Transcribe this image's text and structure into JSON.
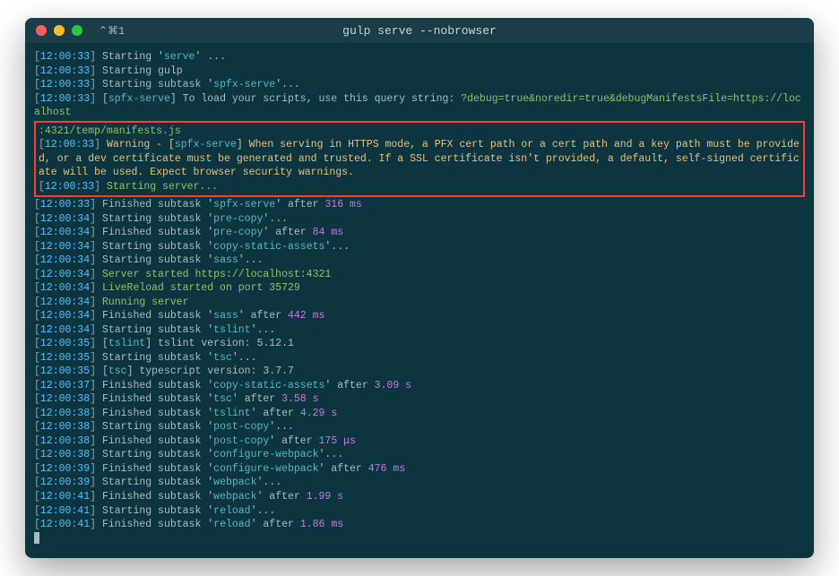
{
  "window": {
    "tab_indicator": "⌃⌘1",
    "title": "gulp serve --nobrowser"
  },
  "highlight_block": {
    "line1_pre": ":4321/temp/manifests.js",
    "ts": "12:00:33",
    "warn_prefix": "Warning - [",
    "warn_mod": "spfx-serve",
    "warn_msg": "] When serving in HTTPS mode, a PFX cert path or a cert path and a key path must be provided, or a dev certificate must be generated and trusted. If a SSL certificate isn't provided, a default, self-signed certificate will be used. Expect browser security warnings.",
    "start_server": "Starting server..."
  },
  "lines": [
    {
      "ts": "12:00:33",
      "segs": [
        [
          "gray",
          "Starting '"
        ],
        [
          "cyan",
          "serve"
        ],
        [
          "gray",
          "' ..."
        ]
      ]
    },
    {
      "ts": "12:00:33",
      "segs": [
        [
          "gray",
          "Starting gulp"
        ]
      ]
    },
    {
      "ts": "12:00:33",
      "segs": [
        [
          "gray",
          "Starting subtask '"
        ],
        [
          "cyan",
          "spfx-serve"
        ],
        [
          "gray",
          "'..."
        ]
      ]
    },
    {
      "ts": "12:00:33",
      "segs": [
        [
          "gray",
          "["
        ],
        [
          "cyan",
          "spfx-serve"
        ],
        [
          "gray",
          "] To load your scripts, use this query string: "
        ],
        [
          "green",
          "?debug=true&noredir=true&debugManifestsFile=https://localhost"
        ]
      ]
    }
  ],
  "lines_after": [
    {
      "ts": "12:00:33",
      "segs": [
        [
          "gray",
          "Finished subtask '"
        ],
        [
          "cyan",
          "spfx-serve"
        ],
        [
          "gray",
          "' after "
        ],
        [
          "magenta",
          "316 ms"
        ]
      ]
    },
    {
      "ts": "12:00:34",
      "segs": [
        [
          "gray",
          "Starting subtask '"
        ],
        [
          "cyan",
          "pre-copy"
        ],
        [
          "gray",
          "'..."
        ]
      ]
    },
    {
      "ts": "12:00:34",
      "segs": [
        [
          "gray",
          "Finished subtask '"
        ],
        [
          "cyan",
          "pre-copy"
        ],
        [
          "gray",
          "' after "
        ],
        [
          "magenta",
          "84 ms"
        ]
      ]
    },
    {
      "ts": "12:00:34",
      "segs": [
        [
          "gray",
          "Starting subtask '"
        ],
        [
          "cyan",
          "copy-static-assets"
        ],
        [
          "gray",
          "'..."
        ]
      ]
    },
    {
      "ts": "12:00:34",
      "segs": [
        [
          "gray",
          "Starting subtask '"
        ],
        [
          "cyan",
          "sass"
        ],
        [
          "gray",
          "'..."
        ]
      ]
    },
    {
      "ts": "12:00:34",
      "segs": [
        [
          "green",
          "Server started https://localhost:4321"
        ]
      ]
    },
    {
      "ts": "12:00:34",
      "segs": [
        [
          "green",
          "LiveReload started on port 35729"
        ]
      ]
    },
    {
      "ts": "12:00:34",
      "segs": [
        [
          "green",
          "Running server"
        ]
      ]
    },
    {
      "ts": "12:00:34",
      "segs": [
        [
          "gray",
          "Finished subtask '"
        ],
        [
          "cyan",
          "sass"
        ],
        [
          "gray",
          "' after "
        ],
        [
          "magenta",
          "442 ms"
        ]
      ]
    },
    {
      "ts": "12:00:34",
      "segs": [
        [
          "gray",
          "Starting subtask '"
        ],
        [
          "cyan",
          "tslint"
        ],
        [
          "gray",
          "'..."
        ]
      ]
    },
    {
      "ts": "12:00:35",
      "segs": [
        [
          "gray",
          "["
        ],
        [
          "cyan",
          "tslint"
        ],
        [
          "gray",
          "] tslint version: 5.12.1"
        ]
      ]
    },
    {
      "ts": "12:00:35",
      "segs": [
        [
          "gray",
          "Starting subtask '"
        ],
        [
          "cyan",
          "tsc"
        ],
        [
          "gray",
          "'..."
        ]
      ]
    },
    {
      "ts": "12:00:35",
      "segs": [
        [
          "gray",
          "["
        ],
        [
          "cyan",
          "tsc"
        ],
        [
          "gray",
          "] typescript version: 3.7.7"
        ]
      ]
    },
    {
      "ts": "12:00:37",
      "segs": [
        [
          "gray",
          "Finished subtask '"
        ],
        [
          "cyan",
          "copy-static-assets"
        ],
        [
          "gray",
          "' after "
        ],
        [
          "magenta",
          "3.09 s"
        ]
      ]
    },
    {
      "ts": "12:00:38",
      "segs": [
        [
          "gray",
          "Finished subtask '"
        ],
        [
          "cyan",
          "tsc"
        ],
        [
          "gray",
          "' after "
        ],
        [
          "magenta",
          "3.58 s"
        ]
      ]
    },
    {
      "ts": "12:00:38",
      "segs": [
        [
          "gray",
          "Finished subtask '"
        ],
        [
          "cyan",
          "tslint"
        ],
        [
          "gray",
          "' after "
        ],
        [
          "magenta",
          "4.29 s"
        ]
      ]
    },
    {
      "ts": "12:00:38",
      "segs": [
        [
          "gray",
          "Starting subtask '"
        ],
        [
          "cyan",
          "post-copy"
        ],
        [
          "gray",
          "'..."
        ]
      ]
    },
    {
      "ts": "12:00:38",
      "segs": [
        [
          "gray",
          "Finished subtask '"
        ],
        [
          "cyan",
          "post-copy"
        ],
        [
          "gray",
          "' after "
        ],
        [
          "magenta",
          "175 μs"
        ]
      ]
    },
    {
      "ts": "12:00:38",
      "segs": [
        [
          "gray",
          "Starting subtask '"
        ],
        [
          "cyan",
          "configure-webpack"
        ],
        [
          "gray",
          "'..."
        ]
      ]
    },
    {
      "ts": "12:00:39",
      "segs": [
        [
          "gray",
          "Finished subtask '"
        ],
        [
          "cyan",
          "configure-webpack"
        ],
        [
          "gray",
          "' after "
        ],
        [
          "magenta",
          "476 ms"
        ]
      ]
    },
    {
      "ts": "12:00:39",
      "segs": [
        [
          "gray",
          "Starting subtask '"
        ],
        [
          "cyan",
          "webpack"
        ],
        [
          "gray",
          "'..."
        ]
      ]
    },
    {
      "ts": "12:00:41",
      "segs": [
        [
          "gray",
          "Finished subtask '"
        ],
        [
          "cyan",
          "webpack"
        ],
        [
          "gray",
          "' after "
        ],
        [
          "magenta",
          "1.99 s"
        ]
      ]
    },
    {
      "ts": "12:00:41",
      "segs": [
        [
          "gray",
          "Starting subtask '"
        ],
        [
          "cyan",
          "reload"
        ],
        [
          "gray",
          "'..."
        ]
      ]
    },
    {
      "ts": "12:00:41",
      "segs": [
        [
          "gray",
          "Finished subtask '"
        ],
        [
          "cyan",
          "reload"
        ],
        [
          "gray",
          "' after "
        ],
        [
          "magenta",
          "1.86 ms"
        ]
      ]
    }
  ]
}
